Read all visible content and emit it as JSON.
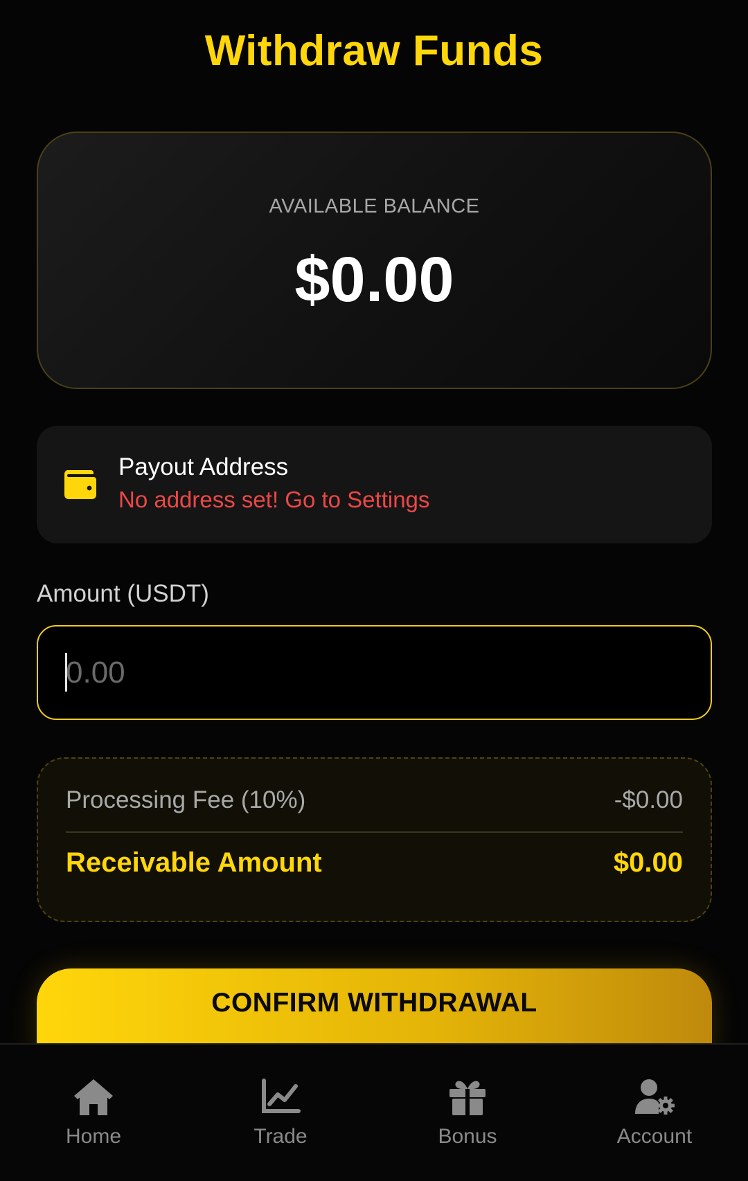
{
  "header": {
    "title": "Withdraw Funds"
  },
  "balance": {
    "label": "AVAILABLE BALANCE",
    "value": "$0.00"
  },
  "payout": {
    "icon": "wallet-icon",
    "title": "Payout Address",
    "warning": "No address set! Go to Settings"
  },
  "amount": {
    "label": "Amount (USDT)",
    "placeholder": "0.00",
    "value": ""
  },
  "fees": {
    "fee_label": "Processing Fee (10%)",
    "fee_value": "-$0.00",
    "receivable_label": "Receivable Amount",
    "receivable_value": "$0.00"
  },
  "confirm": {
    "label": "CONFIRM WITHDRAWAL"
  },
  "nav": {
    "items": [
      {
        "label": "Home",
        "icon": "home-icon"
      },
      {
        "label": "Trade",
        "icon": "chart-line-icon"
      },
      {
        "label": "Bonus",
        "icon": "gift-icon"
      },
      {
        "label": "Account",
        "icon": "user-gear-icon"
      }
    ]
  },
  "colors": {
    "accent": "#FFD60A",
    "warning": "#EE4747",
    "background": "#050505",
    "card": "#151515"
  }
}
